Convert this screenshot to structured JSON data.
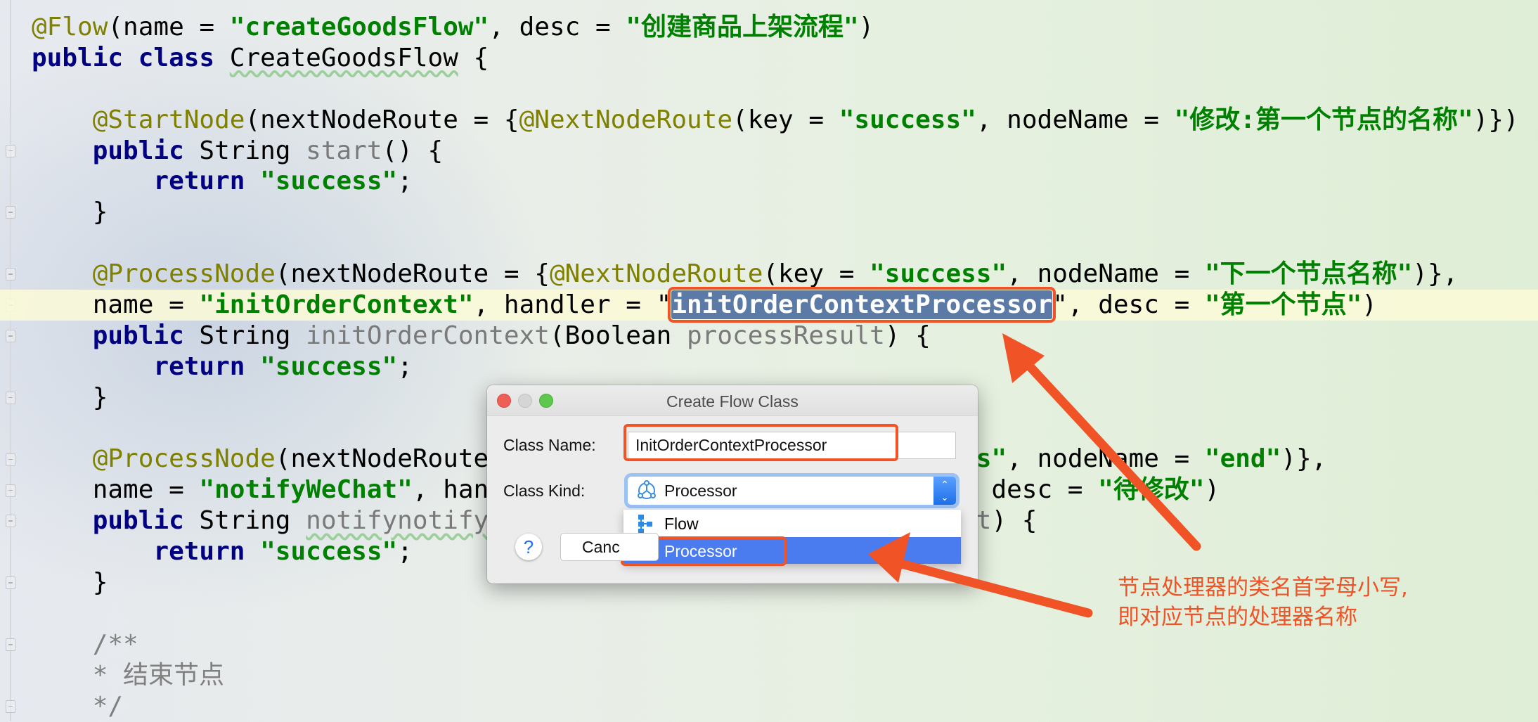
{
  "editor": {
    "lines": [
      [
        [
          "ann",
          "@Flow"
        ],
        [
          "p",
          "(name = "
        ],
        [
          "str",
          "\"createGoodsFlow\""
        ],
        [
          "p",
          ", desc = "
        ],
        [
          "str",
          "\"创建商品上架流程\""
        ],
        [
          "p",
          ")"
        ]
      ],
      [
        [
          "kw",
          "public class "
        ],
        [
          "p wavy",
          "CreateGoodsFlow"
        ],
        [
          "p",
          " {"
        ]
      ],
      [],
      [
        [
          "p",
          "    "
        ],
        [
          "ann",
          "@StartNode"
        ],
        [
          "p",
          "(nextNodeRoute = {"
        ],
        [
          "ann",
          "@NextNodeRoute"
        ],
        [
          "p",
          "(key = "
        ],
        [
          "str",
          "\"success\""
        ],
        [
          "p",
          ", nodeName = "
        ],
        [
          "str",
          "\"修改:第一个节点的名称\""
        ],
        [
          "p",
          ")})"
        ]
      ],
      [
        [
          "p",
          "    "
        ],
        [
          "kw",
          "public"
        ],
        [
          "p",
          " String "
        ],
        [
          "fn",
          "start"
        ],
        [
          "p",
          "() {"
        ]
      ],
      [
        [
          "p",
          "        "
        ],
        [
          "kw",
          "return "
        ],
        [
          "str",
          "\"success\""
        ],
        [
          "p",
          ";"
        ]
      ],
      [
        [
          "p",
          "    }"
        ]
      ],
      [],
      [
        [
          "p",
          "    "
        ],
        [
          "ann",
          "@ProcessNode"
        ],
        [
          "p",
          "(nextNodeRoute = {"
        ],
        [
          "ann",
          "@NextNodeRoute"
        ],
        [
          "p",
          "(key = "
        ],
        [
          "str",
          "\"success\""
        ],
        [
          "p",
          ", nodeName = "
        ],
        [
          "str",
          "\"下一个节点名称\""
        ],
        [
          "p",
          ")},"
        ]
      ],
      [
        [
          "p",
          "    name = "
        ],
        [
          "str",
          "\"initOrderContext\""
        ],
        [
          "p",
          ", handler = \""
        ],
        [
          "sel",
          "initOrderContextProcessor"
        ],
        [
          "p",
          "\", desc = "
        ],
        [
          "str",
          "\"第一个节点\""
        ],
        [
          "p",
          ")"
        ]
      ],
      [
        [
          "p",
          "    "
        ],
        [
          "kw",
          "public"
        ],
        [
          "p",
          " String "
        ],
        [
          "fn",
          "initOrderContext"
        ],
        [
          "p",
          "(Boolean "
        ],
        [
          "fn",
          "processResult"
        ],
        [
          "p",
          ") {"
        ]
      ],
      [
        [
          "p",
          "        "
        ],
        [
          "kw",
          "return "
        ],
        [
          "str",
          "\"success\""
        ],
        [
          "p",
          ";"
        ]
      ],
      [
        [
          "p",
          "    }"
        ]
      ],
      [],
      [
        [
          "p",
          "    "
        ],
        [
          "ann",
          "@ProcessNode"
        ],
        [
          "p",
          "(nextNodeRoute"
        ]
      ],
      [
        [
          "p",
          "    name = "
        ],
        [
          "str",
          "\"notifyWeChat\""
        ],
        [
          "p",
          ", han"
        ]
      ],
      [
        [
          "p",
          "    "
        ],
        [
          "kw",
          "public"
        ],
        [
          "p",
          " String "
        ],
        [
          "fn wavy",
          "notifynotify"
        ]
      ],
      [
        [
          "p",
          "        "
        ],
        [
          "kw",
          "return "
        ],
        [
          "str",
          "\"success\""
        ],
        [
          "p",
          ";"
        ]
      ],
      [
        [
          "p",
          "    }"
        ]
      ],
      [],
      [
        [
          "cm",
          "    /**"
        ]
      ],
      [
        [
          "cm",
          "    * 结束节点"
        ]
      ],
      [
        [
          "cm",
          "    */"
        ]
      ]
    ],
    "right_fragments": {
      "14": [
        [
          "str",
          "ss\""
        ],
        [
          "p",
          ", nodeName = "
        ],
        [
          "str",
          "\"end\""
        ],
        [
          "p",
          ")},"
        ]
      ],
      "15": [
        [
          "p",
          "desc = "
        ],
        [
          "str",
          "\"待修改\""
        ],
        [
          "p",
          ")"
        ]
      ],
      "16": [
        [
          "fn",
          "t"
        ],
        [
          "p",
          ") {"
        ]
      ]
    },
    "current_line": 9
  },
  "dialog": {
    "title": "Create Flow Class",
    "class_name_label": "Class Name:",
    "class_name_value": "InitOrderContextProcessor",
    "class_kind_label": "Class Kind:",
    "class_kind_value": "Processor",
    "options": [
      "Flow",
      "Processor"
    ],
    "selected_option": "Processor",
    "help_label": "?",
    "cancel_label": "Canc"
  },
  "annotation": {
    "line1": "节点处理器的类名首字母小写,",
    "line2": "即对应节点的处理器名称",
    "color": "#ef5326"
  },
  "colors": {
    "annotation": "#808000",
    "keyword": "#000080",
    "string": "#008000",
    "selection": "#5b7aa5",
    "dropdown_highlight": "#4a7cf0"
  }
}
